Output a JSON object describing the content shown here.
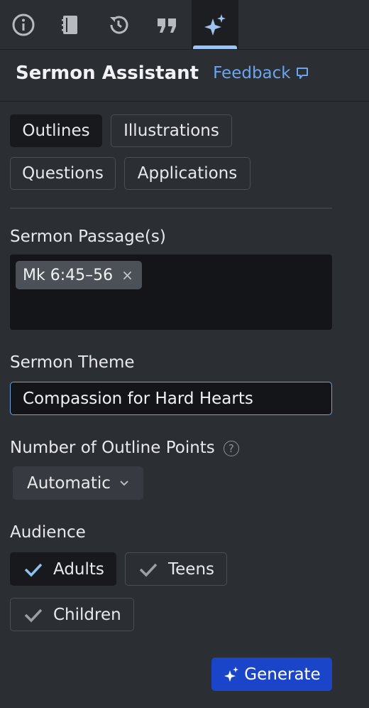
{
  "tabs": [
    {
      "icon": "info-icon",
      "active": false
    },
    {
      "icon": "notebook-icon",
      "active": false
    },
    {
      "icon": "history-icon",
      "active": false
    },
    {
      "icon": "quote-icon",
      "active": false
    },
    {
      "icon": "sparkle-icon",
      "active": true
    }
  ],
  "header": {
    "title": "Sermon Assistant",
    "feedback": "Feedback",
    "feedback_icon": "speech-bubble-icon"
  },
  "modes": [
    {
      "label": "Outlines",
      "active": true
    },
    {
      "label": "Illustrations",
      "active": false
    },
    {
      "label": "Questions",
      "active": false
    },
    {
      "label": "Applications",
      "active": false
    }
  ],
  "passage": {
    "label": "Sermon Passage(s)",
    "tag": "Mk 6:45–56",
    "remove": "×"
  },
  "theme": {
    "label": "Sermon Theme",
    "value": "Compassion for Hard Hearts"
  },
  "outline_points": {
    "label": "Number of Outline Points",
    "help": "?",
    "selected": "Automatic"
  },
  "audience": {
    "label": "Audience",
    "options": [
      {
        "label": "Adults",
        "checked": true
      },
      {
        "label": "Teens",
        "checked": false
      },
      {
        "label": "Children",
        "checked": false
      }
    ]
  },
  "generate": {
    "label": "Generate",
    "icon": "sparkle-icon"
  },
  "colors": {
    "accent": "#6aa5ee",
    "primary_button": "#1b45c8",
    "background": "#2b2e33"
  }
}
